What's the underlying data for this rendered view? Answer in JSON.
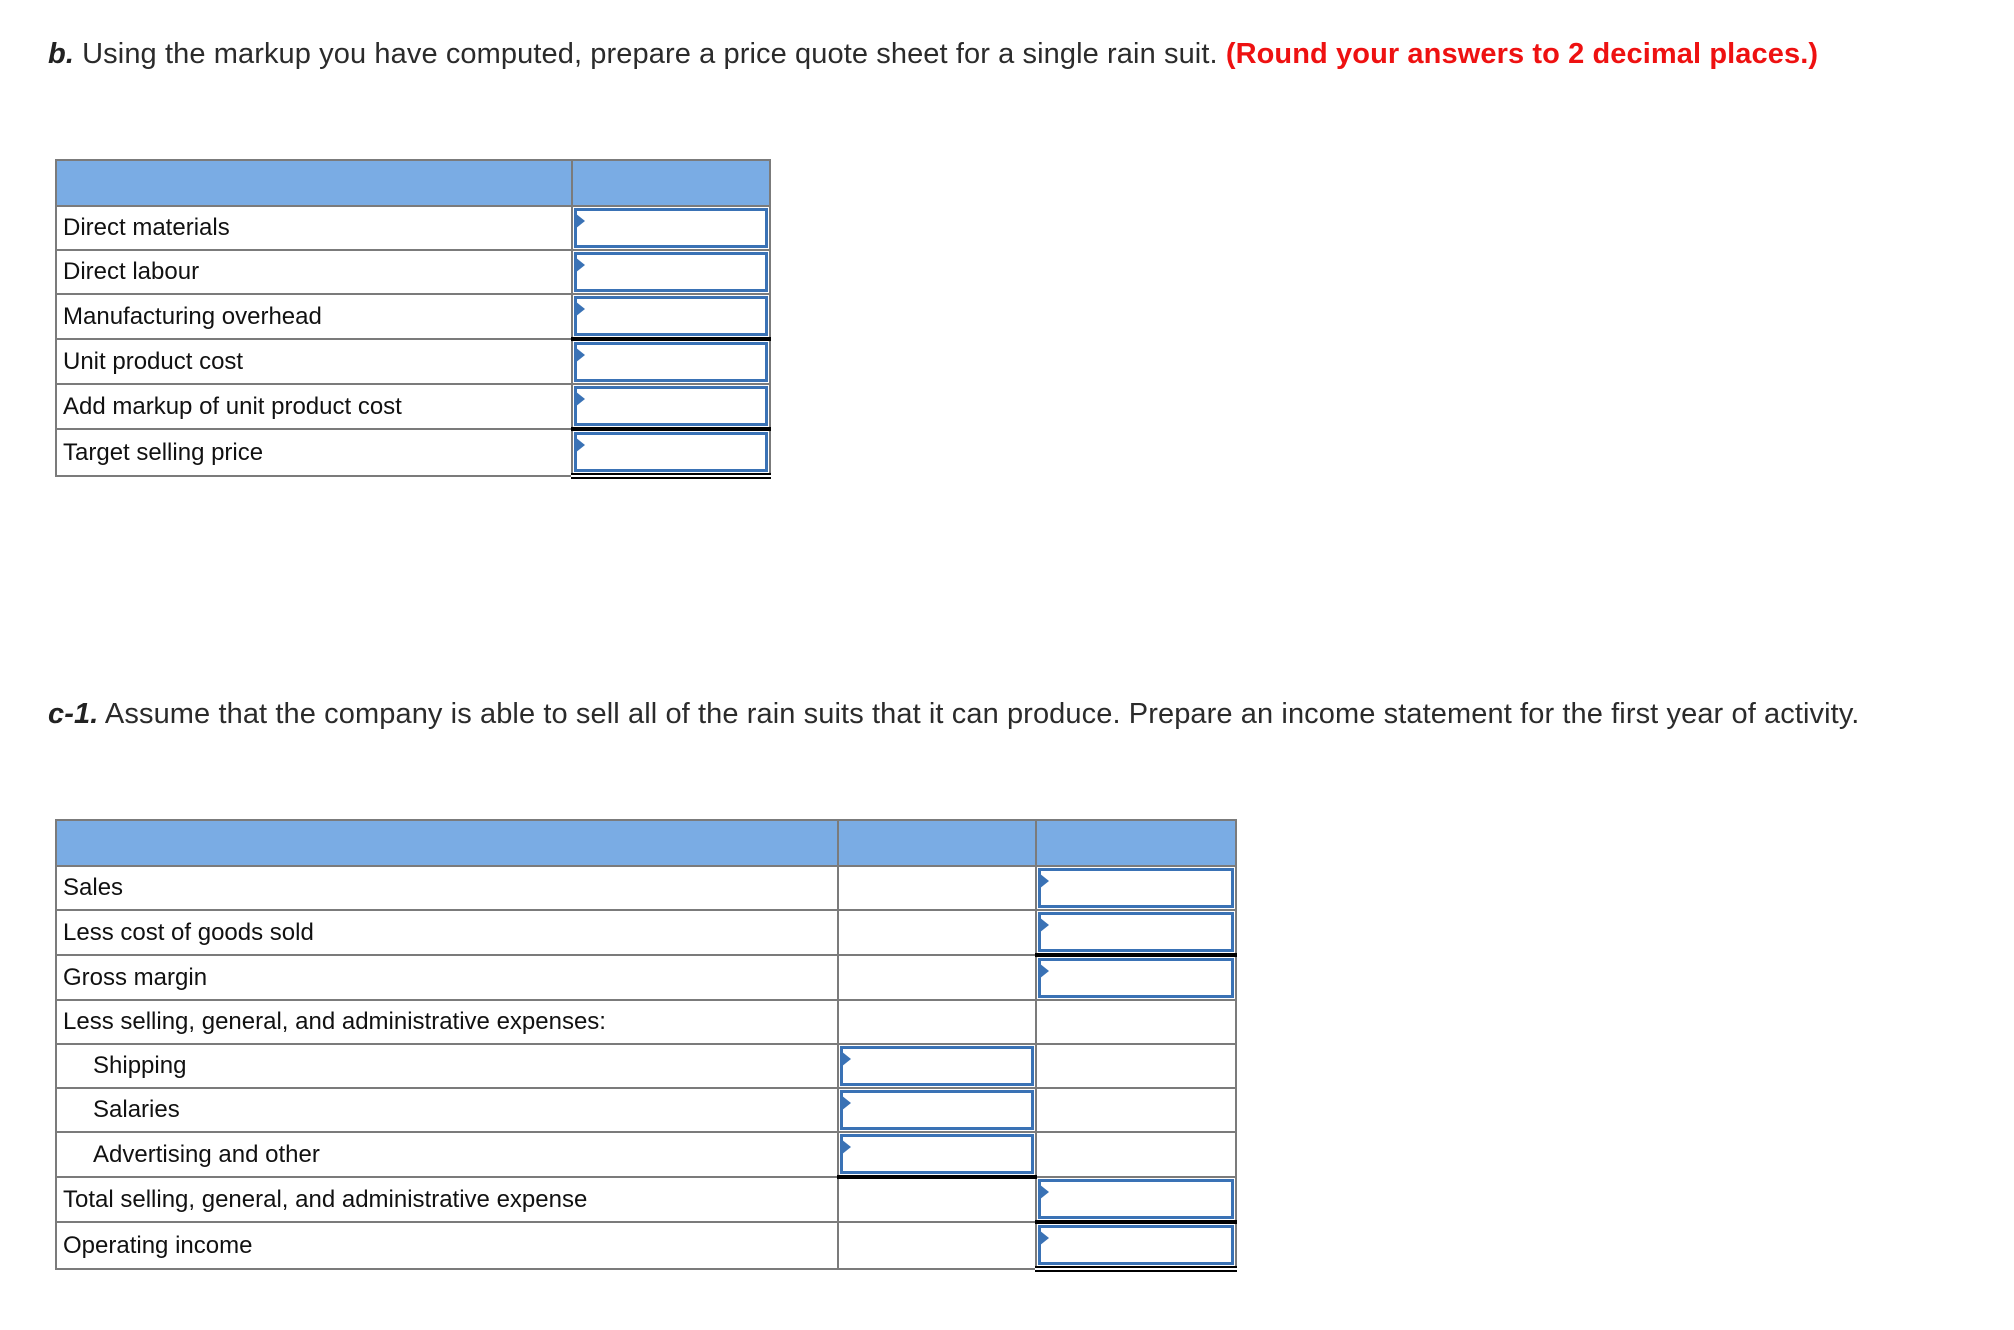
{
  "part_b": {
    "label": "b.",
    "text": " Using the markup you have computed, prepare a price quote sheet for a single rain suit. ",
    "note": "(Round your answers to 2 decimal places.)",
    "table": {
      "rows": [
        {
          "label": "Direct materials",
          "value": ""
        },
        {
          "label": "Direct labour",
          "value": ""
        },
        {
          "label": "Manufacturing overhead",
          "value": ""
        },
        {
          "label": "Unit product cost",
          "value": ""
        },
        {
          "label": "Add markup of unit product cost",
          "value": ""
        },
        {
          "label": "Target selling price",
          "value": ""
        }
      ]
    }
  },
  "part_c1": {
    "label": "c-1.",
    "text": " Assume that the company is able to sell all of the rain suits that it can produce. Prepare an income statement for the first year of activity.",
    "table": {
      "rows": [
        {
          "label": "Sales",
          "col1": "",
          "col2": ""
        },
        {
          "label": "Less cost of goods sold",
          "col1": "",
          "col2": ""
        },
        {
          "label": "Gross margin",
          "col1": "",
          "col2": ""
        },
        {
          "label": "Less selling, general, and administrative expenses:",
          "col1": "",
          "col2": ""
        },
        {
          "label": "Shipping",
          "col1": "",
          "col2": ""
        },
        {
          "label": "Salaries",
          "col1": "",
          "col2": ""
        },
        {
          "label": "Advertising and other",
          "col1": "",
          "col2": ""
        },
        {
          "label": "Total selling, general, and administrative expense",
          "col1": "",
          "col2": ""
        },
        {
          "label": "Operating income",
          "col1": "",
          "col2": ""
        }
      ]
    }
  },
  "colors": {
    "header_fill": "#7aace4",
    "input_border": "#3a72b5",
    "note_red": "#ee1111"
  }
}
